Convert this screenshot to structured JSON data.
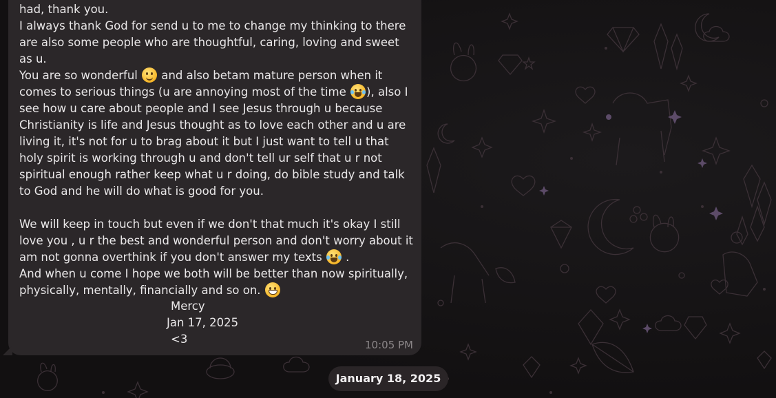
{
  "chat": {
    "message": {
      "lines_block": [
        "had, thank you.",
        "I always thank God for send u to me to change my thinking to there are also some people who are thoughtful, caring, loving and sweet as u."
      ],
      "p1_a": "had, thank you.\nI always thank God for send u to me to change my thinking to there are also some people who are thoughtful, caring, loving and sweet as u.\nYou are so wonderful ",
      "p1_b": " and also betam mature person when it comes to serious things (u are annoying most of the time ",
      "p1_c": "), also I see how u care about people and I see Jesus through u because Christianity is life and Jesus thought as to love each other and u are living it, it's not for u to brag about it but I just want to tell u that holy spirit is working through u and don't tell ur self that u r not spiritual enough rather keep what u r doing, do bible study and talk to God and he will do what is good for you.\n\nWe will keep in touch but even if we don't that much it's okay I still love you , u r the best and wonderful person and don't worry about it am not gonna overthink if you don't answer my texts ",
      "p1_d": " .\nAnd when u come I hope we both will be better than now spiritually, physically, mentally, financially and so on. ",
      "signature_name": "Mercy",
      "signature_date": "Jan 17, 2025",
      "signature_heart": "<3",
      "time": "10:05 PM",
      "emojis": [
        "slightly-smiling-face",
        "face-with-tears-of-joy",
        "face-with-tears-of-joy",
        "grinning-face-with-smiling-eyes"
      ]
    },
    "date_separator": "January 18, 2025"
  },
  "colors": {
    "background": "#141213",
    "bubble": "#2b2729",
    "text": "#e9e7e8",
    "time": "#8c8789",
    "pattern": "#3a2f35"
  }
}
